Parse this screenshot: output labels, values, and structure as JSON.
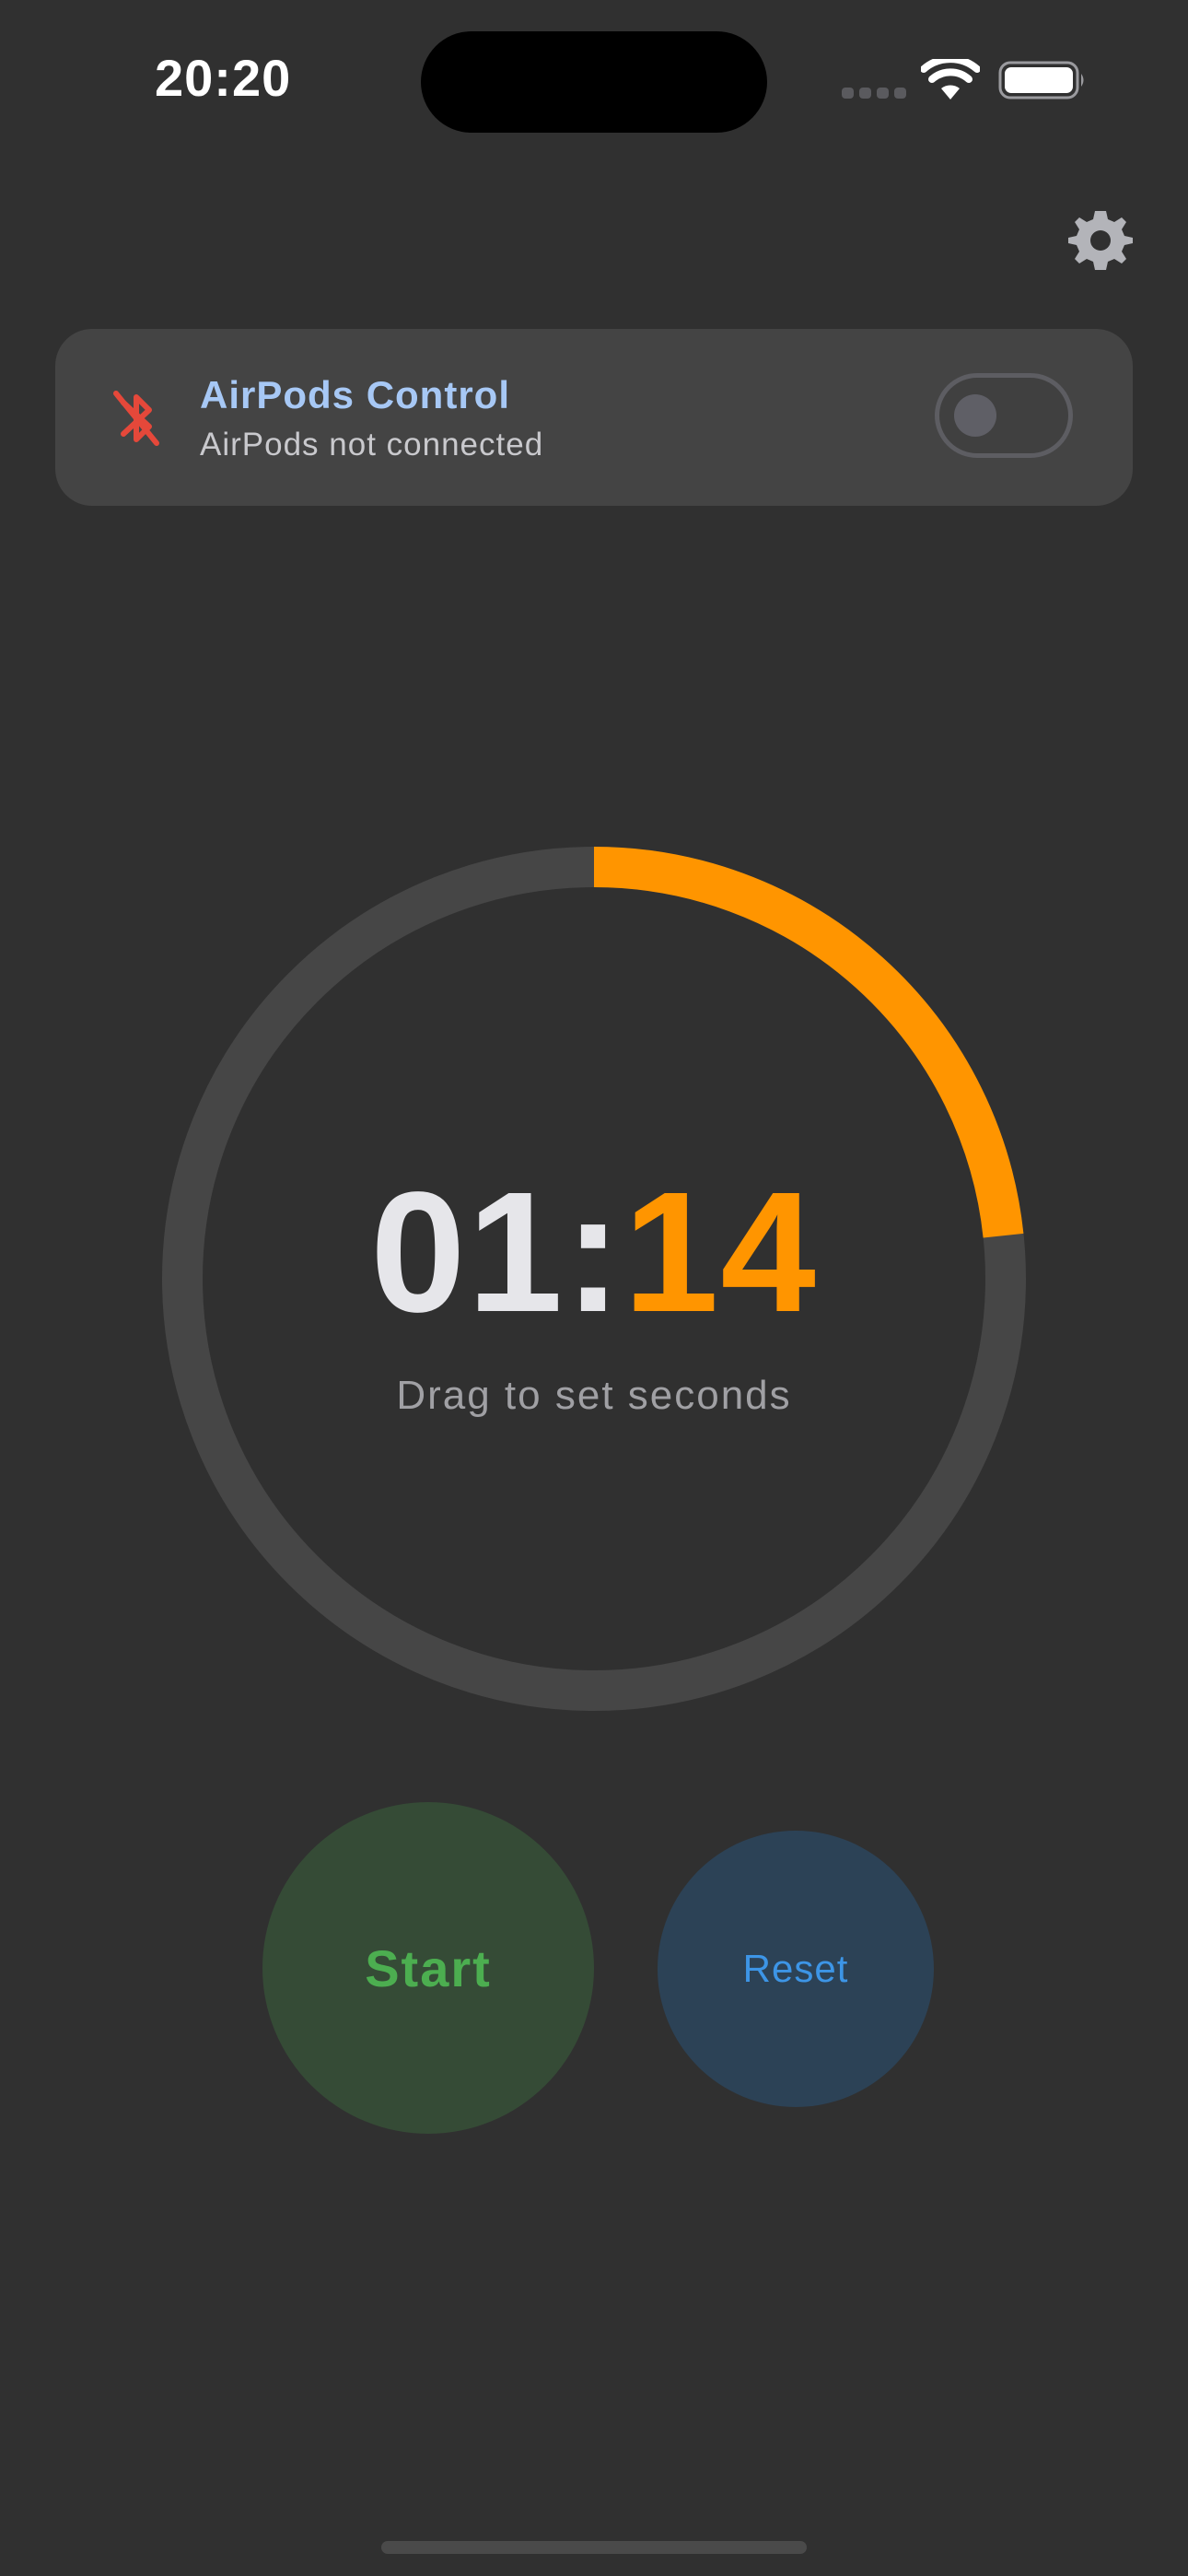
{
  "status_bar": {
    "time": "20:20",
    "wifi_icon": "wifi-icon",
    "battery_icon": "battery-icon"
  },
  "header": {
    "settings_icon": "gear-icon"
  },
  "airpods_card": {
    "icon": "bluetooth-disabled-icon",
    "title": "AirPods Control",
    "subtitle": "AirPods not connected",
    "toggle_on": false
  },
  "timer": {
    "minutes": "01",
    "separator": ":",
    "seconds": "14",
    "hint": "Drag to set seconds",
    "progress_fraction": 0.2333
  },
  "buttons": {
    "start_label": "Start",
    "reset_label": "Reset"
  },
  "colors": {
    "background": "#303030",
    "accent": "#ff9500",
    "start": "#4cae50",
    "reset": "#3d95e6",
    "bluetooth_off": "#e5483a",
    "card_title": "#a7c8f5"
  }
}
